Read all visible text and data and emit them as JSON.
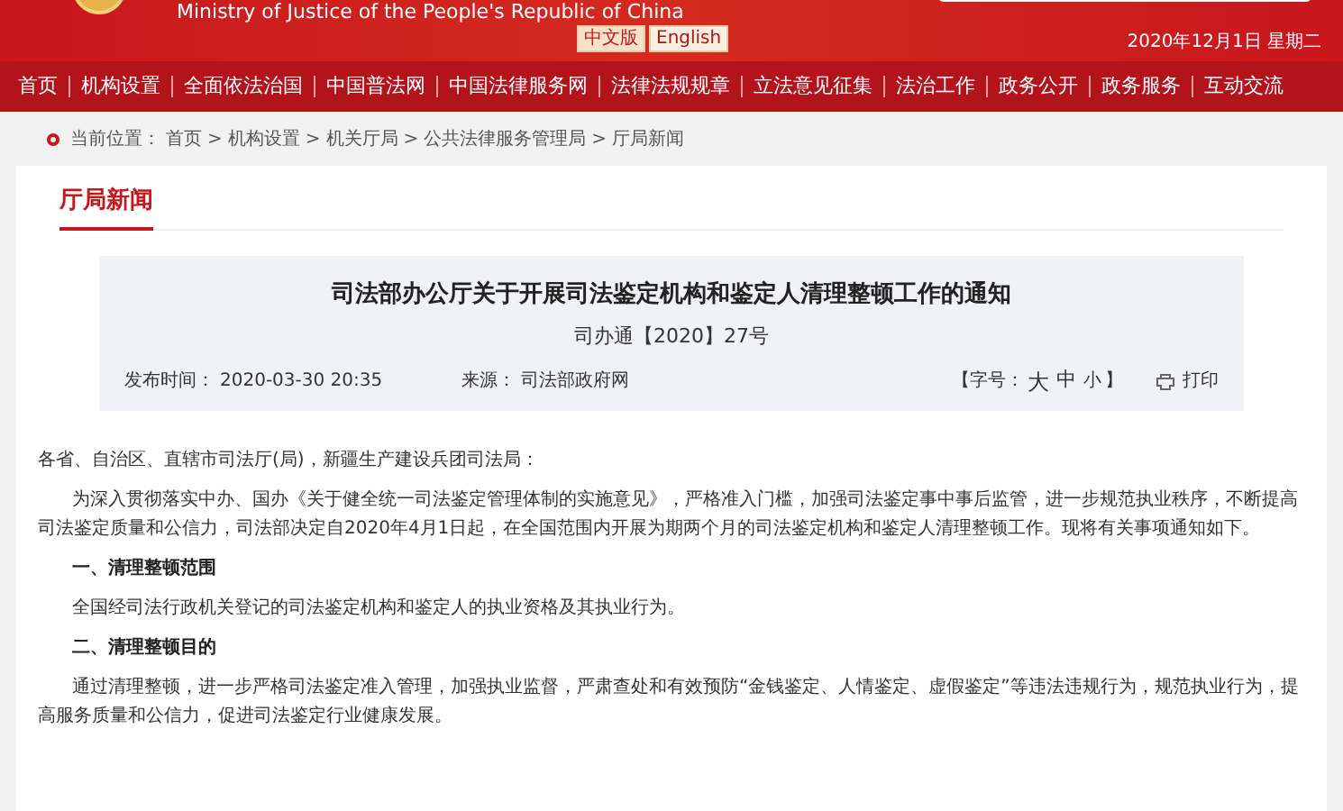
{
  "header": {
    "subtitle": "Ministry of Justice of the People's Republic of China",
    "languages": [
      {
        "label": "中文版",
        "selected": true
      },
      {
        "label": "English",
        "selected": false
      }
    ],
    "date": "2020年12月1日 星期二"
  },
  "nav": [
    "首页",
    "机构设置",
    "全面依法治国",
    "中国普法网",
    "中国法律服务网",
    "法律法规规章",
    "立法意见征集",
    "法治工作",
    "政务公开",
    "政务服务",
    "互动交流"
  ],
  "breadcrumb": {
    "label": "当前位置：",
    "items": [
      "首页",
      "机构设置",
      "机关厅局",
      "公共法律服务管理局",
      "厅局新闻"
    ],
    "separator": ">"
  },
  "section_title": "厅局新闻",
  "article": {
    "title": "司法部办公厅关于开展司法鉴定机构和鉴定人清理整顿工作的通知",
    "doc_number": "司办通【2020】27号",
    "published_label": "发布时间：",
    "published": "2020-03-30 20:35",
    "source_label": "来源：",
    "source": "司法部政府网",
    "font_size_open": "【字号：",
    "font_sizes": [
      "大",
      "中",
      "小"
    ],
    "font_size_close": "】",
    "print": "打印"
  },
  "body": [
    {
      "kind": "salutation",
      "text": "各省、自治区、直辖市司法厅(局)，新疆生产建设兵团司法局："
    },
    {
      "kind": "paragraph",
      "text": "为深入贯彻落实中办、国办《关于健全统一司法鉴定管理体制的实施意见》，严格准入门槛，加强司法鉴定事中事后监管，进一步规范执业秩序，不断提高司法鉴定质量和公信力，司法部决定自2020年4月1日起，在全国范围内开展为期两个月的司法鉴定机构和鉴定人清理整顿工作。现将有关事项通知如下。"
    },
    {
      "kind": "heading",
      "text": "一、清理整顿范围"
    },
    {
      "kind": "paragraph",
      "text": "全国经司法行政机关登记的司法鉴定机构和鉴定人的执业资格及其执业行为。"
    },
    {
      "kind": "heading",
      "text": "二、清理整顿目的"
    },
    {
      "kind": "paragraph",
      "text": "通过清理整顿，进一步严格司法鉴定准入管理，加强执业监督，严肃查处和有效预防“金钱鉴定、人情鉴定、虚假鉴定”等违法违规行为，规范执业行为，提高服务质量和公信力，促进司法鉴定行业健康发展。"
    }
  ]
}
